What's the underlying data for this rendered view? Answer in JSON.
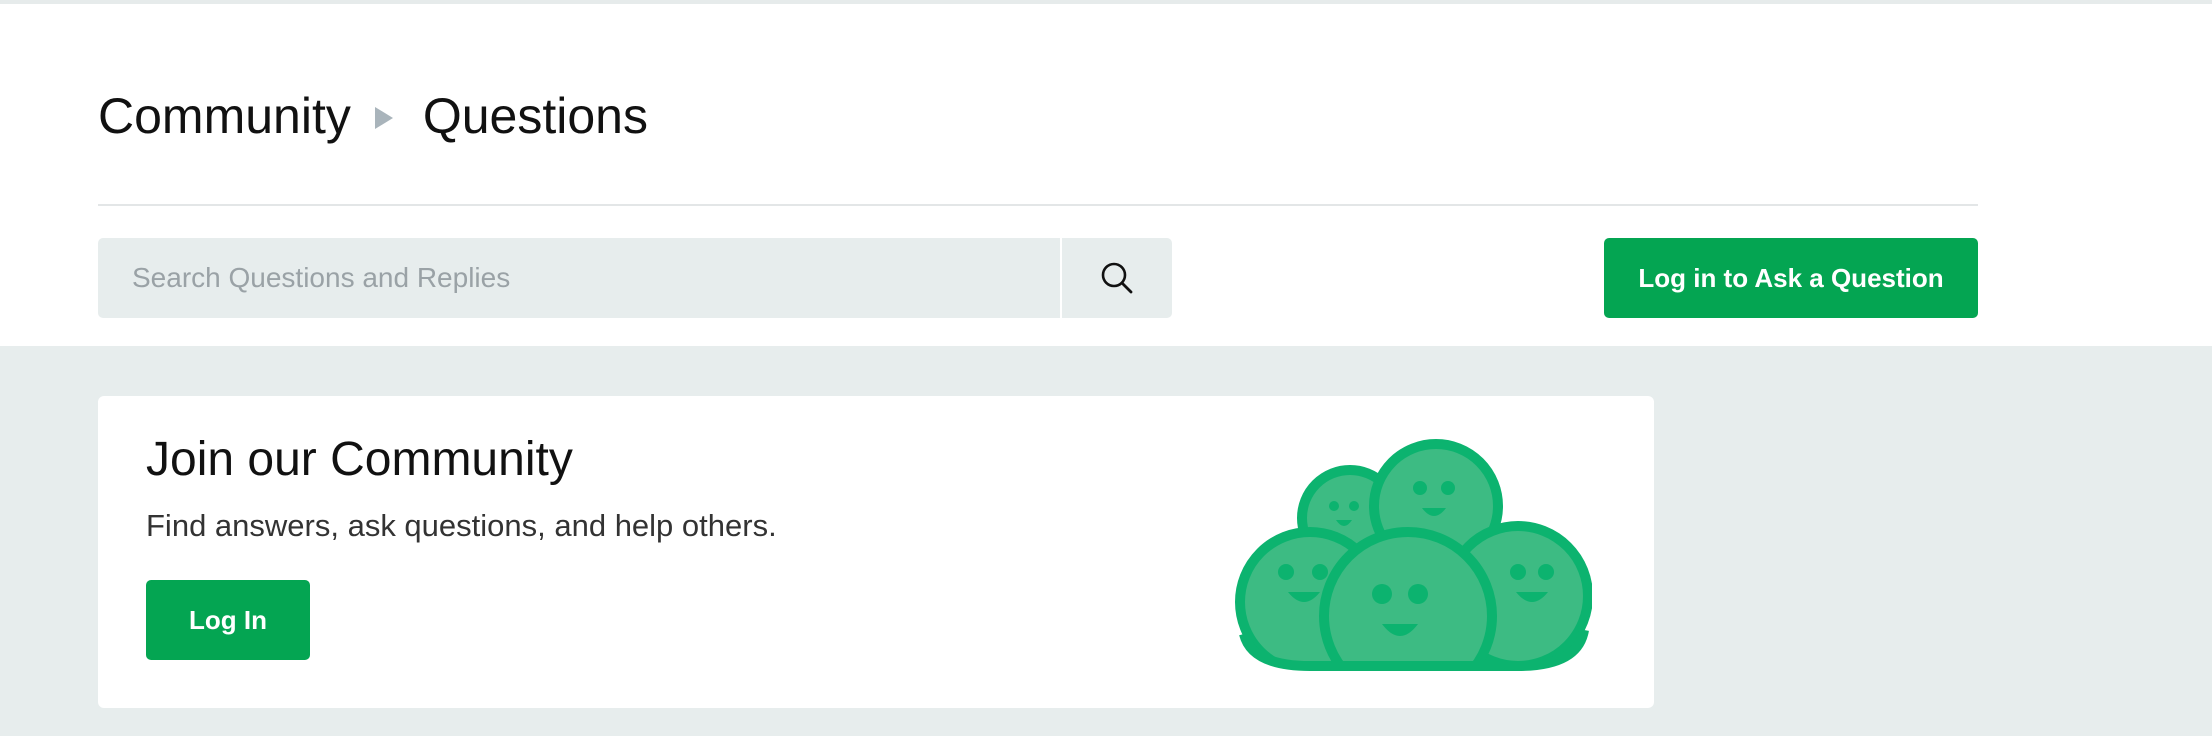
{
  "breadcrumb": {
    "items": [
      "Community",
      "Questions"
    ]
  },
  "search": {
    "placeholder": "Search Questions and Replies",
    "icon": "search-icon"
  },
  "actions": {
    "ask_label": "Log in to Ask a Question"
  },
  "join_card": {
    "title": "Join our Community",
    "subtitle": "Find answers, ask questions, and help others.",
    "login_label": "Log In",
    "illustration": "community-faces-illustration"
  },
  "colors": {
    "accent": "#04a552",
    "illustration_dark": "#0cb36f",
    "illustration_light": "#3dbb83",
    "page_background": "#e7eded",
    "breadcrumb_separator": "#a9b4bb"
  }
}
